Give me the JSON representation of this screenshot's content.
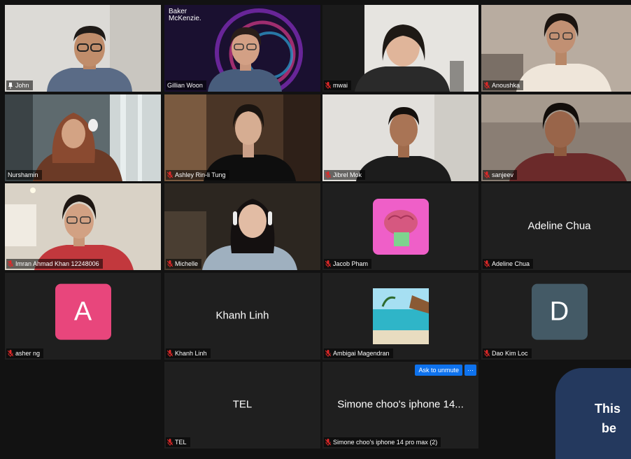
{
  "participants": [
    {
      "name": "John",
      "pinned": true,
      "active": true
    },
    {
      "name": "Gillian Woon",
      "muted": false,
      "logo_line1": "Baker",
      "logo_line2": "McKenzie."
    },
    {
      "name": "mwai",
      "muted": true
    },
    {
      "name": "Anoushka",
      "muted": true
    },
    {
      "name": "Nurshamin",
      "muted": false
    },
    {
      "name": "Ashley Rin-li Tung",
      "muted": true
    },
    {
      "name": "Jibrel Mok",
      "muted": true
    },
    {
      "name": "sanjeev",
      "muted": true
    },
    {
      "name": "Imran Ahmad Khan 12248006",
      "muted": true
    },
    {
      "name": "Michelle",
      "muted": true
    },
    {
      "name": "Jacob Pham",
      "muted": true
    },
    {
      "name": "Adeline Chua",
      "muted": true,
      "display": "Adeline Chua"
    },
    {
      "name": "asher ng",
      "muted": true,
      "avatar_letter": "A"
    },
    {
      "name": "Khanh Linh",
      "muted": true,
      "display": "Khanh Linh"
    },
    {
      "name": "Ambigai Magendran",
      "muted": true
    },
    {
      "name": "Dao Kim Loc",
      "muted": true,
      "avatar_letter": "D"
    },
    {
      "name": "TEL",
      "muted": true,
      "display": "TEL"
    },
    {
      "name": "Simone choo's iphone 14 pro max (2)",
      "muted": true,
      "display": "Simone choo's iphone 14..."
    }
  ],
  "controls": {
    "ask_to_unmute": "Ask to unmute",
    "more": "···"
  },
  "notice": {
    "text": "This\n  be"
  },
  "colors": {
    "active_border": "#2f9e44",
    "muted_mic": "#e02828",
    "button_blue": "#0e72ed",
    "avatar_a": "#e8467c",
    "avatar_d": "#445a66",
    "notice_bg": "#24395e"
  }
}
